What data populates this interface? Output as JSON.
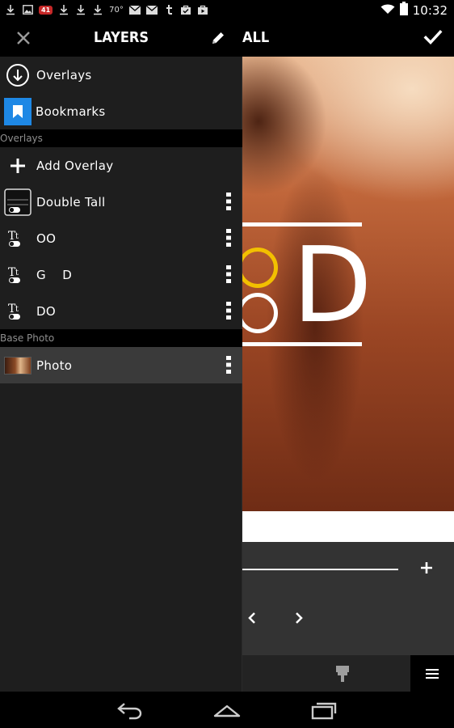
{
  "status_bar": {
    "badge": "41",
    "temperature": "70°",
    "time": "10:32",
    "left_icons": [
      "download-icon",
      "image-icon",
      "notification-badge",
      "download-icon",
      "download-icon",
      "download-icon",
      "temperature",
      "mail-icon",
      "mail-icon",
      "tumblr-icon",
      "bag-icon",
      "play-store-icon"
    ],
    "right_icons": [
      "wifi-icon",
      "battery-icon"
    ]
  },
  "drawer": {
    "title": "LAYERS",
    "items": [
      {
        "label": "Overlays",
        "icon": "download-circle-icon"
      },
      {
        "label": "Bookmarks",
        "icon": "bookmark-icon"
      }
    ],
    "sections": {
      "overlays": {
        "header": "Overlays",
        "add_label": "Add Overlay",
        "layers": [
          {
            "label": "Double Tall",
            "icon": "overlay-thumbnail-icon"
          },
          {
            "label": "OO",
            "icon": "text-layer-icon"
          },
          {
            "label": "G    D",
            "icon": "text-layer-icon"
          },
          {
            "label": "DO",
            "icon": "text-layer-icon"
          }
        ]
      },
      "base_photo": {
        "header": "Base Photo",
        "layers": [
          {
            "label": "Photo",
            "icon": "photo-thumbnail-icon",
            "selected": true
          }
        ]
      }
    }
  },
  "editor": {
    "title": "ALL",
    "canvas_letter": "D",
    "accent_color": "#f2c000",
    "panel_background": "#333333",
    "toolbar_background": "#232323"
  },
  "colors": {
    "drawer_bg": "#1e1e1e",
    "section_bg": "#000000",
    "section_text": "#8e8e8e",
    "bookmark_blue": "#1e88e5",
    "selected_row": "#3a3a3a"
  }
}
